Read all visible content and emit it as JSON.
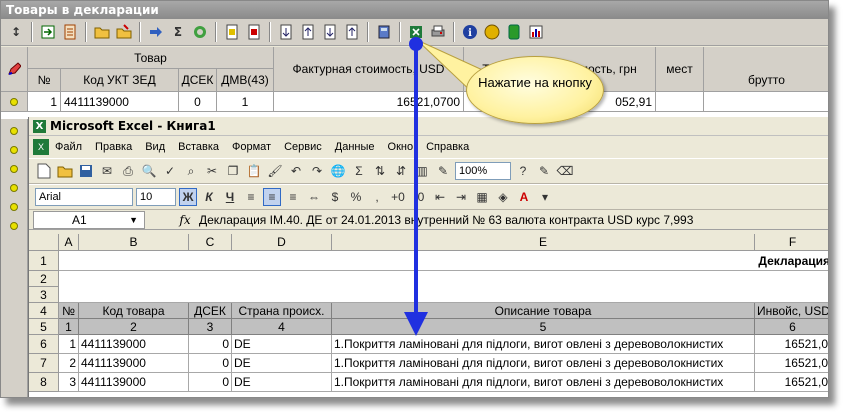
{
  "app": {
    "title": "Товары в декларации"
  },
  "toolbar1": {
    "icons": [
      "split-icon",
      "import-icon",
      "export-doc-icon",
      "open-folder-icon",
      "save-icon",
      "arrow-right-icon",
      "sigma-icon",
      "recycle-icon",
      "doc-a-icon",
      "doc-b-icon",
      "doc-c-icon",
      "doc-d-icon",
      "doc-e-icon",
      "doc-f-icon",
      "calculator-icon",
      "excel-export-icon",
      "print-icon",
      "info-icon",
      "coin-icon",
      "book-icon",
      "chart-icon"
    ],
    "sigma": "Σ",
    "info": "i"
  },
  "grid_top": {
    "group_header": "Товар",
    "headers": {
      "num": "№",
      "code": "Код УКТ ЗЕД",
      "dsek": "ДСЕК",
      "dmv": "ДМВ(43)",
      "invoice": "Фактурная стоимость, USD",
      "customs": "Таможенная стоимость, грн",
      "places": "мест",
      "gross": "брутто"
    },
    "row": {
      "num": "1",
      "code": "4411139000",
      "dsek": "0",
      "dmv": "1",
      "invoice": "16521,0700",
      "customs": "052,91"
    }
  },
  "callout": {
    "text": "Нажатие на кнопку"
  },
  "excel": {
    "title": "Microsoft Excel - Книга1",
    "menu": [
      "Файл",
      "Правка",
      "Вид",
      "Вставка",
      "Формат",
      "Сервис",
      "Данные",
      "Окно",
      "Справка"
    ],
    "zoom": "100%",
    "font": "Arial",
    "size": "10",
    "format_buttons": {
      "bold": "Ж",
      "italic": "К",
      "underline": "Ч"
    },
    "namebox": "A1",
    "fx_label": "fx",
    "formula": "Декларация IM.40. ДЕ от 24.01.2013 внутренний № 63 валюта контракта USD курс 7,993",
    "columns": [
      "A",
      "B",
      "C",
      "D",
      "E",
      "F"
    ],
    "rows": [
      "1",
      "2",
      "3",
      "4",
      "5",
      "6",
      "7",
      "8"
    ],
    "title_cell": "Декларация",
    "header_row": {
      "a": "№",
      "b": "Код товара",
      "c": "ДСЕК",
      "d": "Страна происх.",
      "e": "Описание товара",
      "f": "Инвойс, USD"
    },
    "index_row": {
      "a": "1",
      "b": "2",
      "c": "3",
      "d": "4",
      "e": "5",
      "f": "6"
    },
    "data_rows": [
      {
        "a": "1",
        "b": "4411139000",
        "c": "0",
        "d": "DE",
        "e": "1.Покриття ламіновані для підлоги, вигот овлені з деревоволокнистих",
        "f": "16521,0"
      },
      {
        "a": "2",
        "b": "4411139000",
        "c": "0",
        "d": "DE",
        "e": "1.Покриття ламіновані для підлоги, вигот овлені з деревоволокнистих",
        "f": "16521,0"
      },
      {
        "a": "3",
        "b": "4411139000",
        "c": "0",
        "d": "DE",
        "e": "1.Покриття ламіновані для підлоги, вигот овлені з деревоволокнистих",
        "f": "16521,0"
      }
    ]
  },
  "colors": {
    "arrow": "#2030e0",
    "excel_green": "#1f7a3a",
    "callout_fill": "#fff2a0"
  }
}
